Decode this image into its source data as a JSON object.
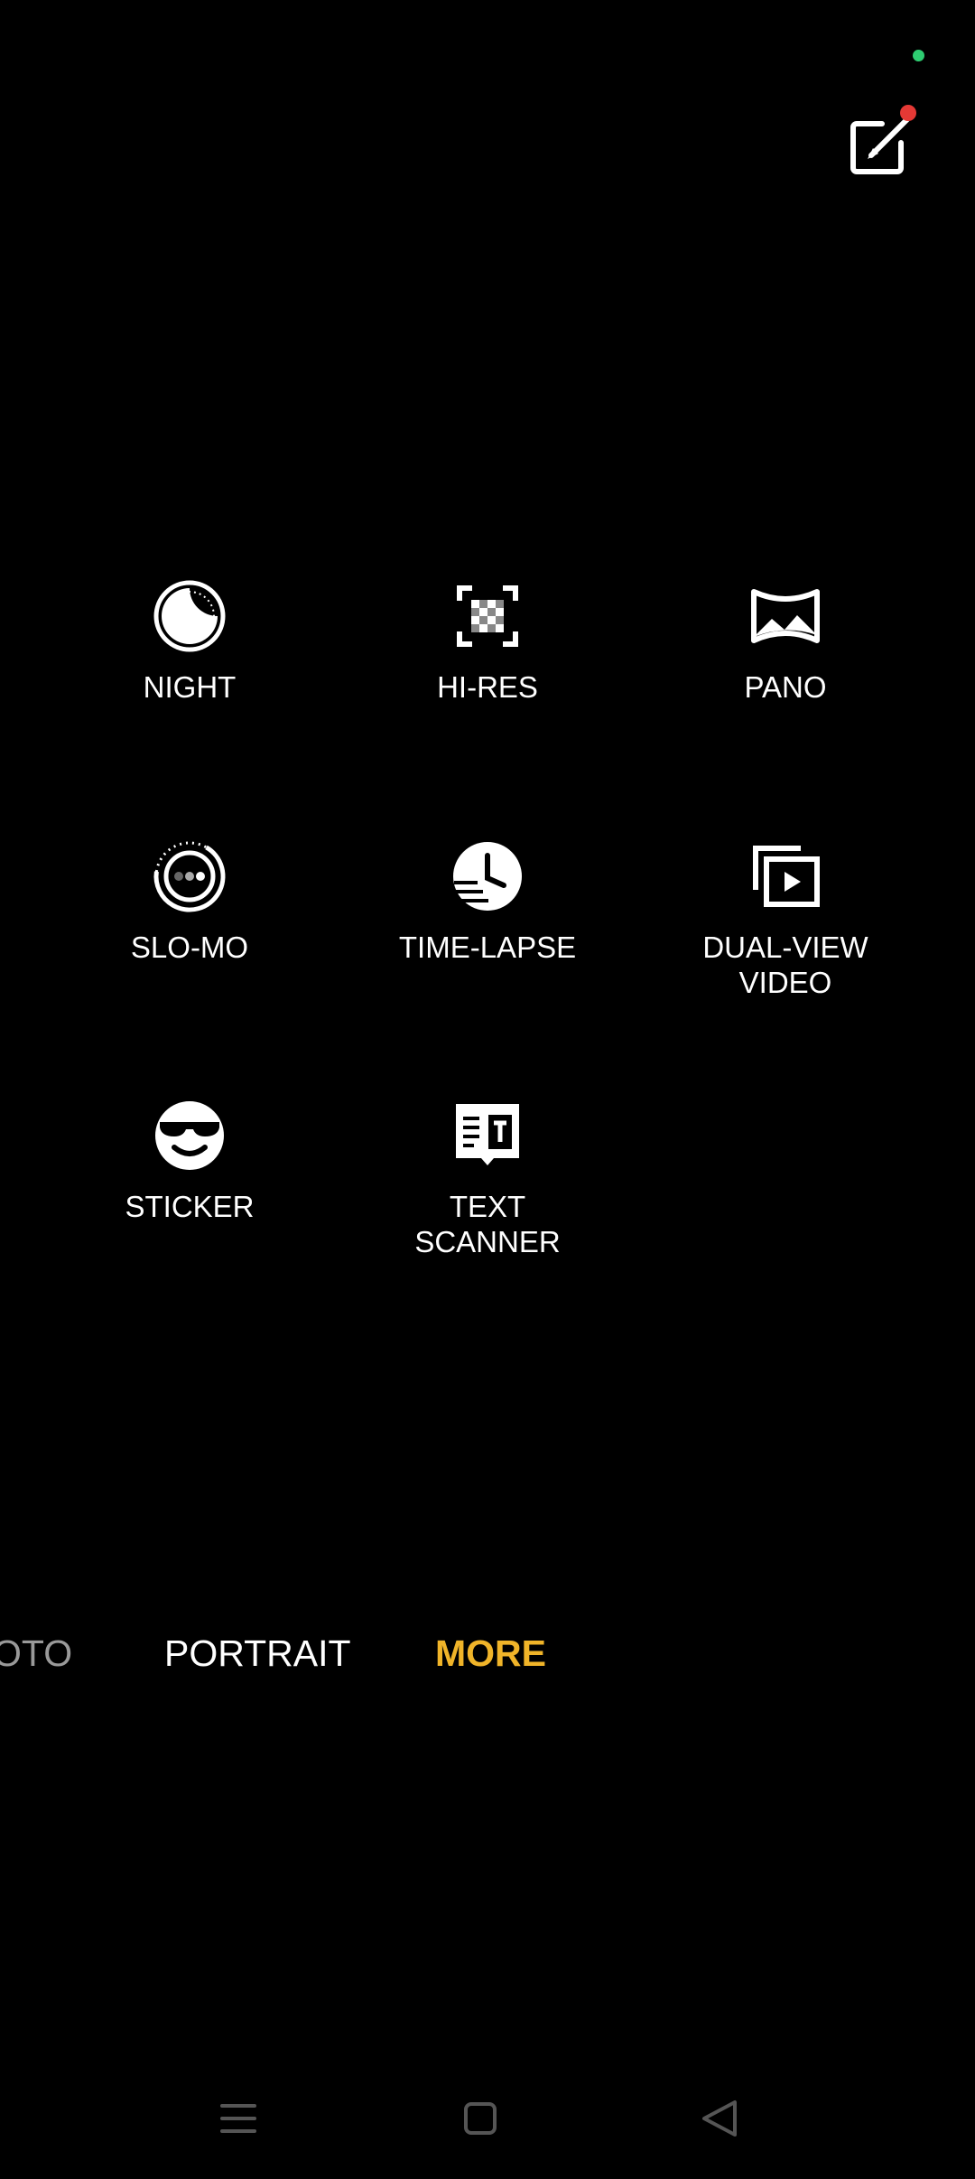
{
  "status": {
    "indicator_color": "#2ecc71"
  },
  "top_bar": {
    "edit_icon": "edit-icon",
    "badge_color": "#e53935"
  },
  "modes": [
    {
      "label": "NIGHT",
      "icon": "night-icon"
    },
    {
      "label": "HI-RES",
      "icon": "hi-res-icon"
    },
    {
      "label": "PANO",
      "icon": "pano-icon"
    },
    {
      "label": "SLO-MO",
      "icon": "slo-mo-icon"
    },
    {
      "label": "TIME-LAPSE",
      "icon": "time-lapse-icon"
    },
    {
      "label": "DUAL-VIEW\nVIDEO",
      "icon": "dual-view-video-icon"
    },
    {
      "label": "STICKER",
      "icon": "sticker-icon"
    },
    {
      "label": "TEXT\nSCANNER",
      "icon": "text-scanner-icon"
    }
  ],
  "mode_tabs": {
    "items": [
      "OTO",
      "PORTRAIT",
      "MORE"
    ],
    "selected": "MORE",
    "accent_color": "#f0b429"
  },
  "nav_bar": {
    "icons": [
      "menu-icon",
      "home-icon",
      "back-icon"
    ]
  }
}
